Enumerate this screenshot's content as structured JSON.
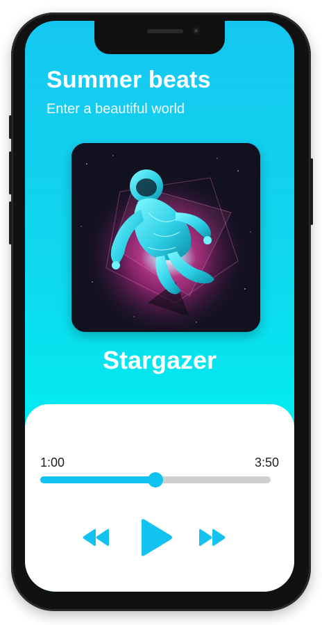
{
  "app": {
    "title": "Summer beats",
    "subtitle": "Enter a beautiful world"
  },
  "now_playing": {
    "song_title": "Stargazer",
    "album_art": "astronaut-artwork"
  },
  "player": {
    "elapsed": "1:00",
    "total": "3:50",
    "progress": 0.5
  },
  "controls": {
    "rewind_icon": "rewind-icon",
    "play_icon": "play-icon",
    "forward_icon": "fast-forward-icon"
  },
  "colors": {
    "accent": "#13c2ef",
    "gradient_top": "#15c7f0",
    "gradient_bottom": "#00f2ef",
    "track": "#cfcfcf"
  }
}
